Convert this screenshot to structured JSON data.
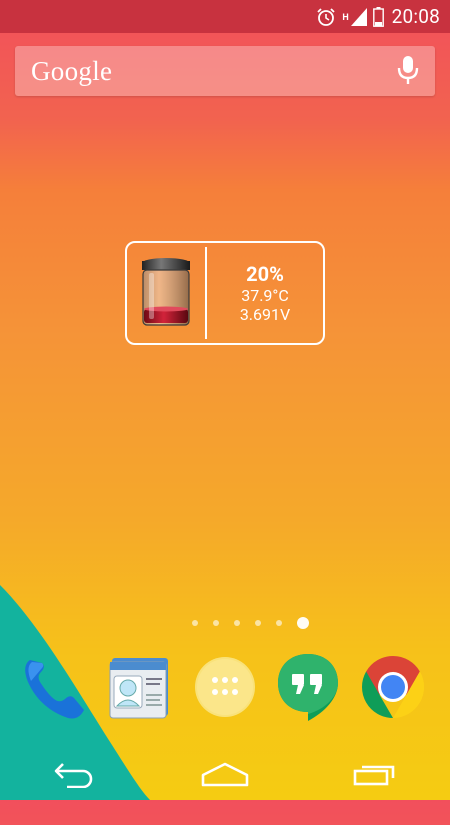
{
  "status_bar": {
    "time": "20:08",
    "network_label": "H",
    "icons": [
      "alarm-icon",
      "signal-icon",
      "battery-icon"
    ]
  },
  "search": {
    "logo_text": "Google",
    "mic_icon": "mic-icon"
  },
  "battery_widget": {
    "percent": "20%",
    "temperature": "37.9°C",
    "voltage": "3.691V",
    "level": 0.2
  },
  "home_pages": {
    "count": 6,
    "current": 6
  },
  "dock": {
    "apps": [
      {
        "name": "Phone",
        "icon": "phone-icon"
      },
      {
        "name": "People",
        "icon": "contacts-icon"
      },
      {
        "name": "Apps",
        "icon": "app-drawer-icon"
      },
      {
        "name": "Hangouts",
        "icon": "hangouts-icon"
      },
      {
        "name": "Chrome",
        "icon": "chrome-icon"
      }
    ]
  },
  "nav_bar": {
    "buttons": [
      "back-icon",
      "home-icon",
      "recents-icon"
    ]
  },
  "colors": {
    "status_bar": "#c8323f",
    "wallpaper_top": "#f24f5c",
    "wallpaper_bottom": "#f5cc12",
    "wave": "#13b39e"
  }
}
